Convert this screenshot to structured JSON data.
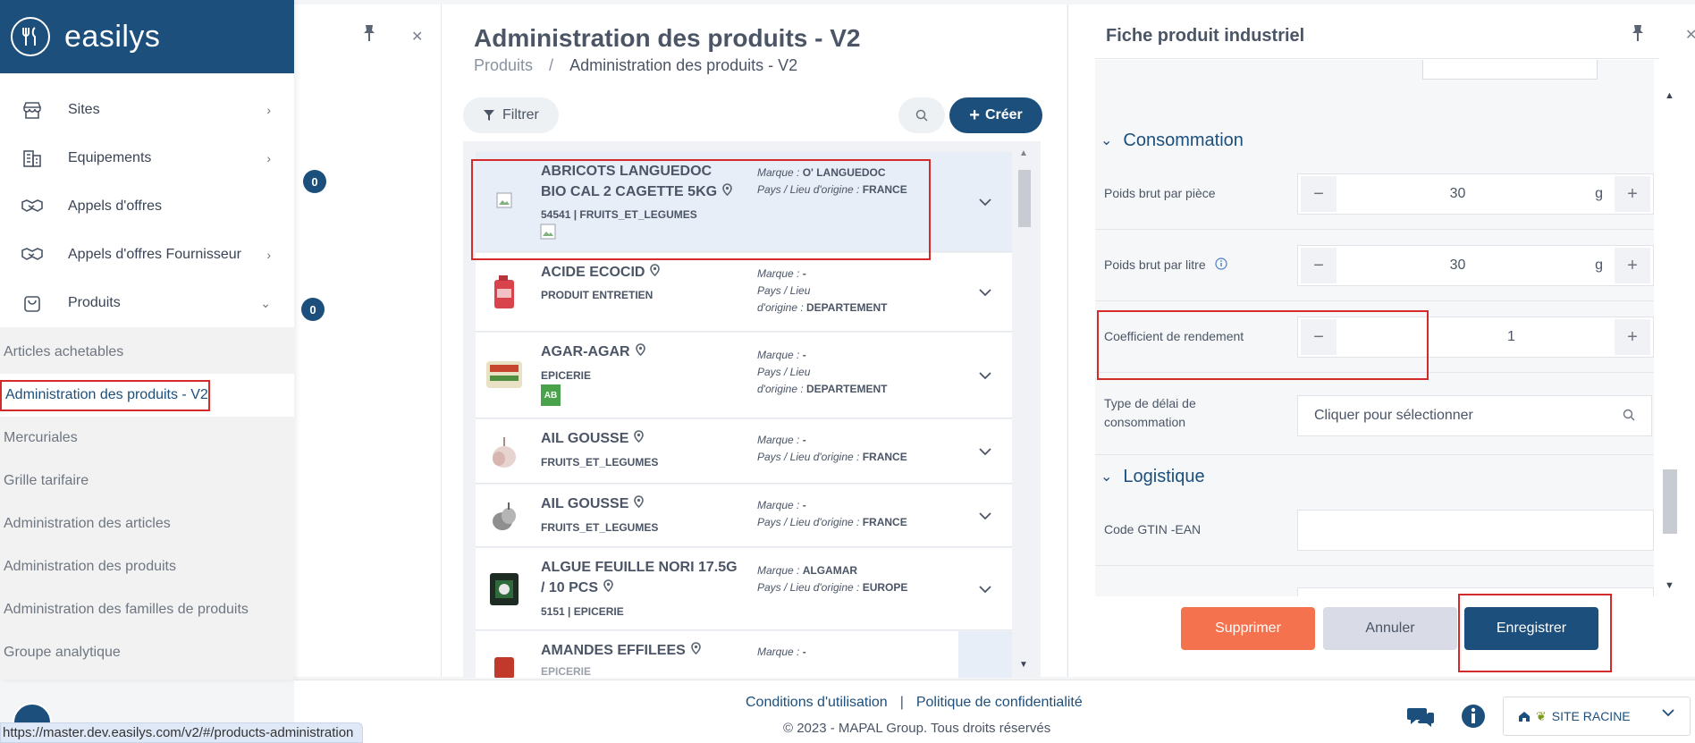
{
  "brand": {
    "name": "easilys"
  },
  "sidebar": {
    "items": [
      {
        "label": "Sites",
        "icon": "store-icon"
      },
      {
        "label": "Equipements",
        "icon": "building-icon"
      },
      {
        "label": "Appels d'offres",
        "icon": "handshake-icon"
      },
      {
        "label": "Appels d'offres Fournisseur",
        "icon": "handshake-icon"
      },
      {
        "label": "Produits",
        "icon": "bag-icon"
      }
    ],
    "sub_items": [
      "Articles achetables",
      "Administration des produits - V2",
      "Mercuriales",
      "Grille tarifaire",
      "Administration des articles",
      "Administration des produits",
      "Administration des familles de produits",
      "Groupe analytique"
    ],
    "badge_products": "0",
    "badge_top": "0"
  },
  "middle": {
    "title": "Administration des produits - V2",
    "breadcrumb": [
      "Produits",
      "Administration des produits - V2"
    ],
    "filter_label": "Filtrer",
    "create_label": "Créer",
    "meta_brand": "Marque : ",
    "meta_origin": "Pays / Lieu d'origine : ",
    "meta_origin_1": "Pays / Lieu",
    "meta_origin_2": "d'origine : ",
    "products": [
      {
        "name": "ABRICOTS LANGUEDOC BIO CAL 2 CAGETTE 5KG",
        "category": "54541 | FRUITS_ET_LEGUMES",
        "brand": "O' LANGUEDOC",
        "origin": "FRANCE"
      },
      {
        "name": "ACIDE ECOCID",
        "category": "PRODUIT ENTRETIEN",
        "brand": "-",
        "origin": "DEPARTEMENT"
      },
      {
        "name": "AGAR-AGAR",
        "category": "EPICERIE",
        "brand": "-",
        "origin": "DEPARTEMENT"
      },
      {
        "name": "AIL GOUSSE",
        "category": "FRUITS_ET_LEGUMES",
        "brand": "-",
        "origin": "FRANCE"
      },
      {
        "name": "AIL GOUSSE",
        "category": "FRUITS_ET_LEGUMES",
        "brand": "-",
        "origin": "FRANCE"
      },
      {
        "name": "ALGUE FEUILLE NORI 17.5G / 10 PCS",
        "category": "5151 | EPICERIE",
        "brand": "ALGAMAR",
        "origin": "EUROPE"
      },
      {
        "name": "AMANDES EFFILEES",
        "category": "EPICERIE",
        "brand": "-",
        "origin": ""
      }
    ]
  },
  "right": {
    "title": "Fiche produit industriel",
    "sections": {
      "consumption": "Consommation",
      "logistics": "Logistique"
    },
    "fields": {
      "gross_per_piece": {
        "label": "Poids brut par pièce",
        "value": "30",
        "unit": "g"
      },
      "gross_per_litre": {
        "label": "Poids brut par litre",
        "value": "30",
        "unit": "g"
      },
      "yield": {
        "label": "Coefficient de rendement",
        "value": "1"
      },
      "delay_type": {
        "label": "Type de délai de consommation",
        "placeholder": "Cliquer pour sélectionner"
      },
      "gtin": {
        "label": "Code GTIN -EAN",
        "value": ""
      }
    },
    "buttons": {
      "delete": "Supprimer",
      "cancel": "Annuler",
      "save": "Enregistrer"
    }
  },
  "footer": {
    "terms": "Conditions d'utilisation",
    "privacy": "Politique de confidentialité",
    "copyright": "© 2023 - MAPAL Group. Tous droits réservés",
    "site": "SITE RACINE"
  },
  "status_url": "https://master.dev.easilys.com/v2/#/products-administration",
  "colors": {
    "primary": "#1c4f7c",
    "danger": "#f4734e",
    "highlight": "#d42a2a"
  }
}
